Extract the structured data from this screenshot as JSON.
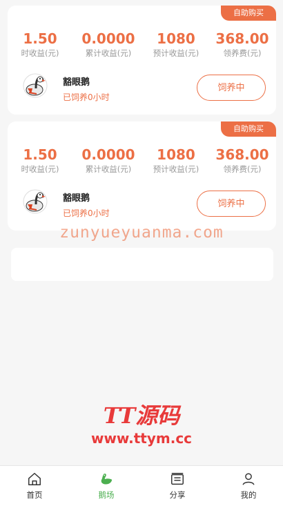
{
  "cards": [
    {
      "badge": "自助购买",
      "stats": [
        {
          "value": "1.50",
          "label": "时收益(元)"
        },
        {
          "value": "0.0000",
          "label": "累计收益(元)"
        },
        {
          "value": "1080",
          "label": "预计收益(元)"
        },
        {
          "value": "368.00",
          "label": "领养费(元)"
        }
      ],
      "pet_name": "豁眼鹅",
      "pet_status": "已饲养0小时",
      "button": "饲养中"
    },
    {
      "badge": "自助购买",
      "stats": [
        {
          "value": "1.50",
          "label": "时收益(元)"
        },
        {
          "value": "0.0000",
          "label": "累计收益(元)"
        },
        {
          "value": "1080",
          "label": "预计收益(元)"
        },
        {
          "value": "368.00",
          "label": "领养费(元)"
        }
      ],
      "pet_name": "豁眼鹅",
      "pet_status": "已饲养0小时",
      "button": "饲养中"
    }
  ],
  "watermark": "zunyueyuanma.com",
  "logo": {
    "title": "TT源码",
    "url": "www.ttym.cc"
  },
  "tabbar": [
    {
      "label": "首页",
      "icon": "home-icon"
    },
    {
      "label": "鹅场",
      "icon": "goose-icon",
      "active": true
    },
    {
      "label": "分享",
      "icon": "share-icon"
    },
    {
      "label": "我的",
      "icon": "user-icon"
    }
  ],
  "colors": {
    "accent": "#ec6f45",
    "active_tab": "#4caf50"
  }
}
